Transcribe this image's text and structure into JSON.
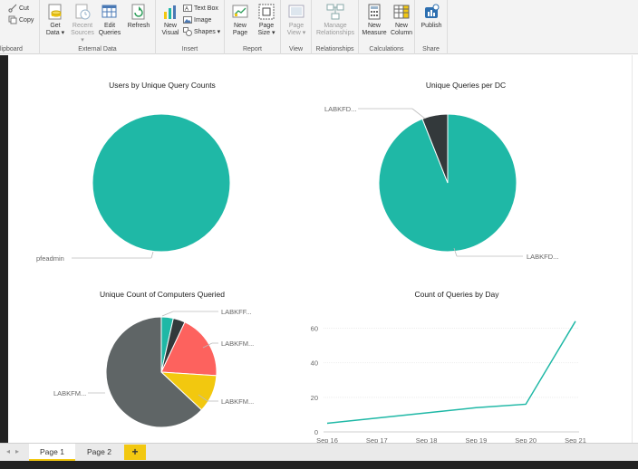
{
  "ribbon": {
    "clipboard": {
      "label": "lipboard",
      "cut": "Cut",
      "copy": "Copy"
    },
    "external_data": {
      "label": "External Data",
      "get_data": [
        "Get",
        "Data ▾"
      ],
      "recent_sources": [
        "Recent",
        "Sources ▾"
      ],
      "edit_queries": [
        "Edit",
        "Queries"
      ],
      "refresh": "Refresh"
    },
    "insert": {
      "label": "Insert",
      "new_visual": [
        "New",
        "Visual"
      ],
      "text_box": "Text Box",
      "image": "Image",
      "shapes": "Shapes ▾"
    },
    "report": {
      "label": "Report",
      "new_page": [
        "New",
        "Page"
      ],
      "page_size": [
        "Page",
        "Size ▾"
      ]
    },
    "view": {
      "label": "View",
      "page_view": [
        "Page",
        "View ▾"
      ]
    },
    "relationships": {
      "label": "Relationships",
      "manage": [
        "Manage",
        "Relationships"
      ]
    },
    "calculations": {
      "label": "Calculations",
      "new_measure": [
        "New",
        "Measure"
      ],
      "new_column": [
        "New",
        "Column"
      ]
    },
    "share": {
      "label": "Share",
      "publish": "Publish"
    }
  },
  "colors": {
    "teal": "#1fb8a6",
    "dark": "#33393b",
    "gray": "#5f6566",
    "red": "#fd625e",
    "yellow": "#f2c80f",
    "accent": "#f2c811"
  },
  "visuals": {
    "v1": {
      "title": "Users by Unique Query Counts",
      "chart_data": {
        "type": "pie",
        "title": "Users by Unique Query Counts",
        "slices": [
          {
            "label": "pfeadmin",
            "value": 100
          }
        ]
      }
    },
    "v2": {
      "title": "Unique Queries per DC",
      "chart_data": {
        "type": "pie",
        "title": "Unique Queries per DC",
        "slices": [
          {
            "label": "LABKFD...",
            "value": 94
          },
          {
            "label": "LABKFD...",
            "value": 6
          }
        ]
      }
    },
    "v3": {
      "title": "Unique Count of Computers Queried",
      "chart_data": {
        "type": "pie",
        "title": "Unique Count of Computers Queried",
        "slices": [
          {
            "label": "LABKFF...",
            "value": 3.5
          },
          {
            "label": "",
            "value": 3.5
          },
          {
            "label": "LABKFM...",
            "value": 19
          },
          {
            "label": "LABKFM...",
            "value": 11
          },
          {
            "label": "LABKFM...",
            "value": 63
          }
        ]
      }
    },
    "v4": {
      "title": "Count of Queries by Day",
      "chart_data": {
        "type": "line",
        "title": "Count of Queries by Day",
        "categories": [
          "Sep 16",
          "Sep 17",
          "Sep 18",
          "Sep 19",
          "Sep 20",
          "Sep 21"
        ],
        "values": [
          5,
          8,
          11,
          14,
          16,
          64
        ],
        "yticks": [
          0,
          20,
          40,
          60
        ],
        "ylim": [
          0,
          66
        ],
        "grid": true
      }
    }
  },
  "tabs": {
    "pages": [
      "Page 1",
      "Page 2"
    ],
    "add": "+",
    "nav_prev": "◂",
    "nav_next": "▸"
  }
}
